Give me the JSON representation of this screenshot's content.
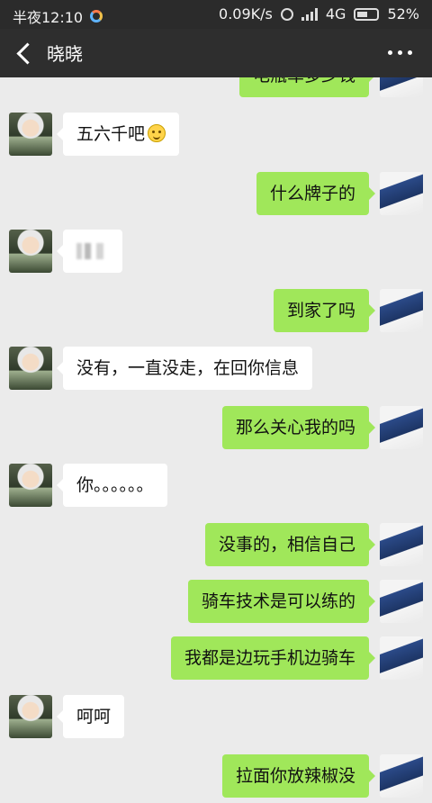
{
  "status_bar": {
    "time": "半夜12:10",
    "speed": "0.09K/s",
    "network": "4G",
    "battery": "52%"
  },
  "header": {
    "title": "晓晓"
  },
  "messages": [
    {
      "side": "right",
      "text": "电瓶车多少钱"
    },
    {
      "side": "left",
      "text": "五六千吧",
      "emoji": "face-emoji"
    },
    {
      "side": "right",
      "text": "什么牌子的"
    },
    {
      "side": "left",
      "text": ""
    },
    {
      "side": "right",
      "text": "到家了吗"
    },
    {
      "side": "left",
      "text": "没有，一直没走，在回你信息"
    },
    {
      "side": "right",
      "text": "那么关心我的吗"
    },
    {
      "side": "left",
      "text": "你。。。。。。"
    },
    {
      "side": "right",
      "text": "没事的，相信自己"
    },
    {
      "side": "right",
      "text": "骑车技术是可以练的"
    },
    {
      "side": "right",
      "text": "我都是边玩手机边骑车"
    },
    {
      "side": "left",
      "text": "呵呵"
    },
    {
      "side": "right",
      "text": "拉面你放辣椒没"
    }
  ]
}
